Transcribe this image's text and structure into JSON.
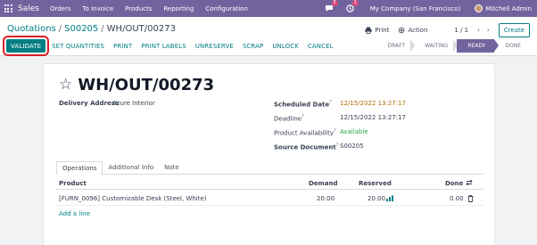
{
  "navbar": {
    "brand": "Sales",
    "menu": [
      "Orders",
      "To Invoice",
      "Products",
      "Reporting",
      "Configuration"
    ],
    "messages_count": "5",
    "activities_count": "1",
    "company": "My Company (San Francisco)",
    "user": "Mitchell Admin"
  },
  "control_panel": {
    "breadcrumb": [
      "Quotations",
      "S00205",
      "WH/OUT/00273"
    ],
    "print_label": "Print",
    "action_label": "Action",
    "pager": "1 / 1",
    "create_label": "Create"
  },
  "buttons": [
    "VALIDATE",
    "SET QUANTITIES",
    "PRINT",
    "PRINT LABELS",
    "UNRESERVE",
    "SCRAP",
    "UNLOCK",
    "CANCEL"
  ],
  "statusbar": {
    "stages": [
      "DRAFT",
      "WAITING",
      "READY",
      "DONE"
    ],
    "active": "READY"
  },
  "record": {
    "name": "WH/OUT/00273",
    "delivery_address_label": "Delivery Address",
    "delivery_address": "Azure Interior",
    "scheduled_date_label": "Scheduled Date",
    "scheduled_date": "12/15/2022 13:27:17",
    "deadline_label": "Deadline",
    "deadline": "12/15/2022 13:27:17",
    "availability_label": "Product Availability",
    "availability": "Available",
    "source_label": "Source Document",
    "source": "S00205"
  },
  "tabs": [
    "Operations",
    "Additional Info",
    "Note"
  ],
  "table": {
    "headers": {
      "product": "Product",
      "demand": "Demand",
      "reserved": "Reserved",
      "done": "Done"
    },
    "rows": [
      {
        "product": "[FURN_0096] Customizable Desk (Steel, White)",
        "demand": "20.00",
        "reserved": "20.00",
        "done": "0.00"
      }
    ],
    "add_line": "Add a line"
  },
  "colors": {
    "brand": "#71639e",
    "primary": "#017e84",
    "highlight": "#d91f26",
    "warning": "#b36b00",
    "success": "#28a745"
  }
}
